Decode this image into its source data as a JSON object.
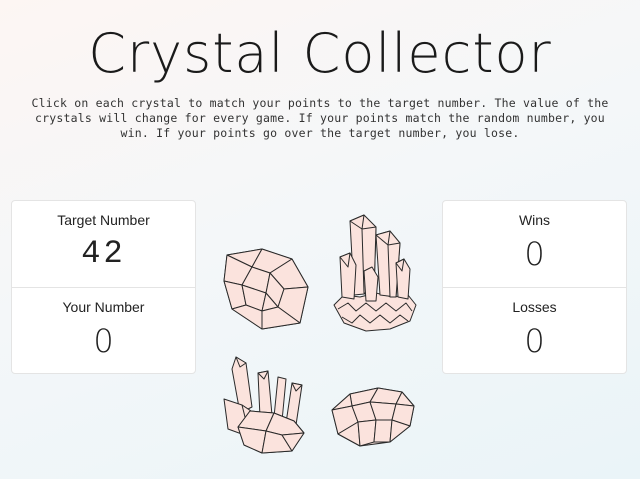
{
  "header": {
    "title": "Crystal Collector",
    "instructions": "Click on each crystal to match your points to the target number. The value of the crystals will change for every game. If your points match the random number, you win. If your points go over the target number, you lose."
  },
  "scoreboard": {
    "target_label": "Target Number",
    "target_value": "42",
    "your_label": "Your Number",
    "your_value": "0",
    "wins_label": "Wins",
    "wins_value": "0",
    "losses_label": "Losses",
    "losses_value": "0"
  },
  "crystals": [
    {
      "icon": "rough-gem-crystal-icon",
      "fill": "#fbe3dd"
    },
    {
      "icon": "quartz-cluster-crystal-icon",
      "fill": "#fbe3dd"
    },
    {
      "icon": "spiky-crystal-icon",
      "fill": "#fbe3dd"
    },
    {
      "icon": "flat-gem-crystal-icon",
      "fill": "#fbe3dd"
    }
  ]
}
